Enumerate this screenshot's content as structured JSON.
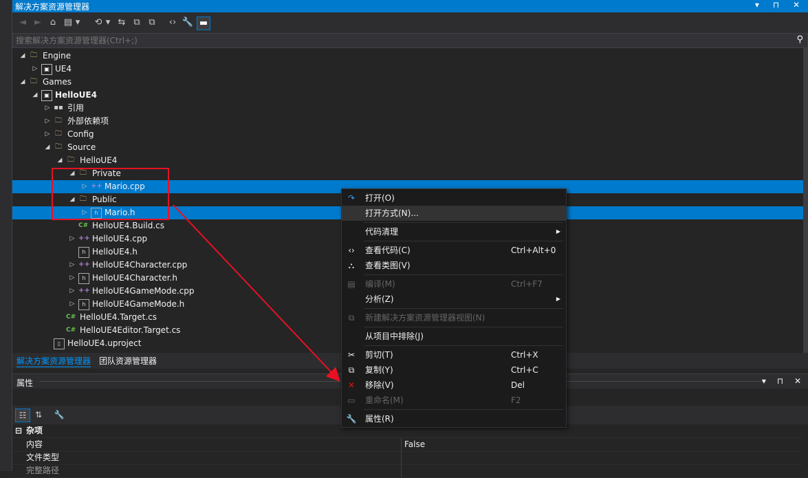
{
  "window": {
    "title": "解决方案资源管理器",
    "controls": [
      "▾",
      "⊓",
      "✕"
    ]
  },
  "toolbar": {
    "buttons": [
      "◄",
      "►",
      "⌂",
      "▤",
      "▾",
      "⟲",
      "▾",
      "⇆",
      "⧉",
      "⧉",
      "‹›",
      "🔧",
      "▬"
    ]
  },
  "search": {
    "placeholder": "搜索解决方案资源管理器(Ctrl+;)",
    "icon": "search-icon"
  },
  "tree": [
    {
      "label": "Engine",
      "icon": "folder",
      "arrow": "◢",
      "level": 1
    },
    {
      "label": "UE4",
      "icon": "proj",
      "arrow": "▷",
      "level": 2
    },
    {
      "label": "Games",
      "icon": "folder",
      "arrow": "◢",
      "level": 1
    },
    {
      "label": "HelloUE4",
      "icon": "proj",
      "arrow": "◢",
      "level": 2,
      "bold": true
    },
    {
      "label": "引用",
      "icon": "ref",
      "arrow": "▷",
      "level": 3
    },
    {
      "label": "外部依赖项",
      "icon": "folder",
      "arrow": "▷",
      "level": 3
    },
    {
      "label": "Config",
      "icon": "folder",
      "arrow": "▷",
      "level": 3
    },
    {
      "label": "Source",
      "icon": "folder",
      "arrow": "◢",
      "level": 3
    },
    {
      "label": "HelloUE4",
      "icon": "folder",
      "arrow": "◢",
      "level": 4
    },
    {
      "label": "Private",
      "icon": "folder",
      "arrow": "◢",
      "level": 5
    },
    {
      "label": "Mario.cpp",
      "icon": "cpp",
      "arrow": "▷",
      "level": 6,
      "selected": true
    },
    {
      "label": "Public",
      "icon": "folder",
      "arrow": "◢",
      "level": 5
    },
    {
      "label": "Mario.h",
      "icon": "h",
      "arrow": "▷",
      "level": 6,
      "selected": true
    },
    {
      "label": "HelloUE4.Build.cs",
      "icon": "cs",
      "arrow": "",
      "level": 5
    },
    {
      "label": "HelloUE4.cpp",
      "icon": "cpp",
      "arrow": "▷",
      "level": 5
    },
    {
      "label": "HelloUE4.h",
      "icon": "h",
      "arrow": "",
      "level": 5
    },
    {
      "label": "HelloUE4Character.cpp",
      "icon": "cpp",
      "arrow": "▷",
      "level": 5
    },
    {
      "label": "HelloUE4Character.h",
      "icon": "h",
      "arrow": "▷",
      "level": 5
    },
    {
      "label": "HelloUE4GameMode.cpp",
      "icon": "cpp",
      "arrow": "▷",
      "level": 5
    },
    {
      "label": "HelloUE4GameMode.h",
      "icon": "h",
      "arrow": "▷",
      "level": 5
    },
    {
      "label": "HelloUE4.Target.cs",
      "icon": "cs",
      "arrow": "",
      "level": 4
    },
    {
      "label": "HelloUE4Editor.Target.cs",
      "icon": "cs",
      "arrow": "",
      "level": 4
    },
    {
      "label": "HelloUE4.uproject",
      "icon": "file",
      "arrow": "",
      "level": 3
    }
  ],
  "tabs": {
    "solution": "解决方案资源管理器",
    "team": "团队资源管理器"
  },
  "properties": {
    "title": "属性",
    "controls": [
      "▾",
      "⊓",
      "✕"
    ],
    "category": "杂项",
    "rows": [
      {
        "key": "内容",
        "value": "False"
      },
      {
        "key": "文件类型",
        "value": ""
      },
      {
        "key": "完整路径",
        "value": ""
      }
    ]
  },
  "context_menu": [
    {
      "icon": "↷",
      "icon_name": "open-icon",
      "label": "打开(O)",
      "shortcut": "",
      "disabled": false,
      "sub": false,
      "color": "#3c9ee8"
    },
    {
      "icon": "",
      "icon_name": "",
      "label": "打开方式(N)...",
      "shortcut": "",
      "disabled": false,
      "sub": false,
      "highlight": true
    },
    {
      "sep": true
    },
    {
      "icon": "",
      "icon_name": "",
      "label": "代码清理",
      "shortcut": "",
      "disabled": false,
      "sub": true
    },
    {
      "sep": true
    },
    {
      "icon": "‹›",
      "icon_name": "view-code-icon",
      "label": "查看代码(C)",
      "shortcut": "Ctrl+Alt+0",
      "disabled": false,
      "sub": false
    },
    {
      "icon": "⛬",
      "icon_name": "class-diagram-icon",
      "label": "查看类图(V)",
      "shortcut": "",
      "disabled": false,
      "sub": false
    },
    {
      "sep": true
    },
    {
      "icon": "▤",
      "icon_name": "compile-icon",
      "label": "编译(M)",
      "shortcut": "Ctrl+F7",
      "disabled": true,
      "sub": false
    },
    {
      "icon": "",
      "icon_name": "",
      "label": "分析(Z)",
      "shortcut": "",
      "disabled": false,
      "sub": true
    },
    {
      "sep": true
    },
    {
      "icon": "⧉",
      "icon_name": "new-view-icon",
      "label": "新建解决方案资源管理器视图(N)",
      "shortcut": "",
      "disabled": true,
      "sub": false
    },
    {
      "sep": true
    },
    {
      "icon": "",
      "icon_name": "",
      "label": "从项目中排除(J)",
      "shortcut": "",
      "disabled": false,
      "sub": false
    },
    {
      "sep": true
    },
    {
      "icon": "✂",
      "icon_name": "cut-icon",
      "label": "剪切(T)",
      "shortcut": "Ctrl+X",
      "disabled": false,
      "sub": false
    },
    {
      "icon": "⧉",
      "icon_name": "copy-icon",
      "label": "复制(Y)",
      "shortcut": "Ctrl+C",
      "disabled": false,
      "sub": false
    },
    {
      "icon": "✕",
      "icon_name": "remove-icon",
      "label": "移除(V)",
      "shortcut": "Del",
      "disabled": false,
      "sub": false,
      "color": "#e51400"
    },
    {
      "icon": "▭",
      "icon_name": "rename-icon",
      "label": "重命名(M)",
      "shortcut": "F2",
      "disabled": true,
      "sub": false
    },
    {
      "sep": true
    },
    {
      "icon": "🔧",
      "icon_name": "wrench-icon",
      "label": "属性(R)",
      "shortcut": "",
      "disabled": false,
      "sub": false
    }
  ],
  "colors": {
    "accent": "#007acc",
    "annotation": "#e81123",
    "background": "#252526"
  }
}
